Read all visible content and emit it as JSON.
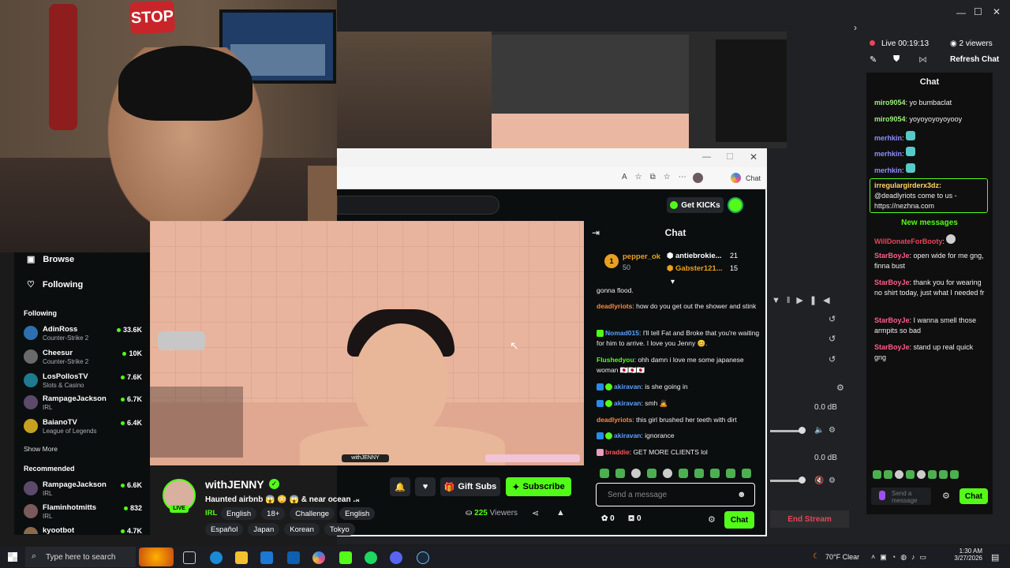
{
  "webcam": {
    "stop_sign": "STOP"
  },
  "obs": {
    "live_label": "Live 00:19:13",
    "viewers_label": "2 viewers",
    "refresh_label": "Refresh Chat",
    "chat_header": "Chat",
    "mixer_db": [
      "0.0 dB",
      "0.0 dB"
    ],
    "end_stream": "End Stream",
    "popout_send_placeholder": "Send a message",
    "popout_chat_button": "Chat",
    "messages": [
      {
        "user": "miro9054",
        "text": "yo bumbaclat",
        "color": "green"
      },
      {
        "user": "miro9054",
        "text": "yoyoyoyoyoyooy",
        "color": "green"
      },
      {
        "user": "merhkin",
        "text": "",
        "color": "purple"
      },
      {
        "user": "merhkin",
        "text": "",
        "color": "purple"
      },
      {
        "user": "merhkin",
        "text": "",
        "color": "purple"
      }
    ],
    "highlight_user": "irregulargirderx3dz:",
    "highlight_text": "@deadlyriots come to us - https://nezhna.com",
    "new_messages": "New messages",
    "messages2": [
      {
        "user": "WillDonateForBooty",
        "text": "",
        "color": "red"
      },
      {
        "user": "StarBoyJe",
        "text": "open wide for me gng, finna bust",
        "color": "pink"
      },
      {
        "user": "StarBoyJe",
        "text": "thank you for wearing no shirt today, just what I needed fr",
        "color": "pink"
      },
      {
        "user": "StarBoyJe",
        "text": "I wanna smell those armpits so bad",
        "color": "pink"
      },
      {
        "user": "StarBoyJe",
        "text": "stand up real quick gng",
        "color": "pink"
      }
    ]
  },
  "browser": {
    "chat_button": "Chat"
  },
  "kick": {
    "get_kicks": "Get KICKs",
    "nav": {
      "browse": "Browse",
      "following": "Following"
    },
    "following_heading": "Following",
    "following": [
      {
        "name": "AdinRoss",
        "game": "Counter-Strike 2",
        "viewers": "33.6K"
      },
      {
        "name": "Cheesur",
        "game": "Counter-Strike 2",
        "viewers": "10K"
      },
      {
        "name": "LosPollosTV",
        "game": "Slots & Casino",
        "viewers": "7.6K"
      },
      {
        "name": "RampageJackson",
        "game": "IRL",
        "viewers": "6.7K"
      },
      {
        "name": "BaianoTV",
        "game": "League of Legends",
        "viewers": "6.4K"
      }
    ],
    "show_more": "Show More",
    "recommended_heading": "Recommended",
    "recommended": [
      {
        "name": "RampageJackson",
        "game": "IRL",
        "viewers": "6.6K"
      },
      {
        "name": "Flaminhotmitts",
        "game": "IRL",
        "viewers": "832"
      },
      {
        "name": "kyootbot",
        "game": "",
        "viewers": "4.7K"
      }
    ],
    "video_handle": "withJENNY",
    "streamer": {
      "name": "withJENNY",
      "title": "Haunted airbnb 😱 😳 😱 & near ocean ...",
      "category": "IRL",
      "tags": [
        "English",
        "18+",
        "Challenge",
        "English",
        "Español",
        "Japan",
        "Korean",
        "Tokyo"
      ],
      "live_badge": "LIVE",
      "viewers": "225",
      "viewers_label": "Viewers",
      "gift_subs": "Gift Subs",
      "subscribe": "Subscribe"
    },
    "chat": {
      "header": "Chat",
      "pinned": [
        {
          "rank": "1",
          "user": "pepper_ok",
          "amount": "50"
        },
        {
          "user": "antiebrokie...",
          "amount": "21"
        },
        {
          "user": "Gabster121...",
          "amount": "15"
        }
      ],
      "messages": [
        {
          "user": "",
          "text": "gonna flood.",
          "color": "orange"
        },
        {
          "user": "deadlyriots",
          "text": "how do you get out the shower and stink",
          "color": "orange"
        },
        {
          "user": "Nomad015",
          "text": "I'll tell Fat and Broke that you're waiting for him to arrive. I love you Jenny 😊.",
          "color": "blue"
        },
        {
          "user": "Flushedyou",
          "text": "ohh damn i love me some japanese woman 🇯🇵🇯🇵🇯🇵",
          "color": "green"
        },
        {
          "user": "akiravan",
          "text": "is she going in",
          "color": "blue"
        },
        {
          "user": "akiravan",
          "text": "smh 🙇",
          "color": "blue"
        },
        {
          "user": "deadlyriots",
          "text": "this girl brushed her teeth with dirt",
          "color": "orange"
        },
        {
          "user": "akiravan",
          "text": "ignorance",
          "color": "blue"
        },
        {
          "user": "braddie",
          "text": "GET MORE CLIENTS lol",
          "color": "red"
        }
      ],
      "placeholder": "Send a message",
      "counter1": "0",
      "counter2": "0",
      "chat_button": "Chat"
    }
  },
  "taskbar": {
    "search_placeholder": "Type here to search",
    "weather": "70°F  Clear",
    "time": "1:30 AM",
    "date": "3/27/2026"
  }
}
